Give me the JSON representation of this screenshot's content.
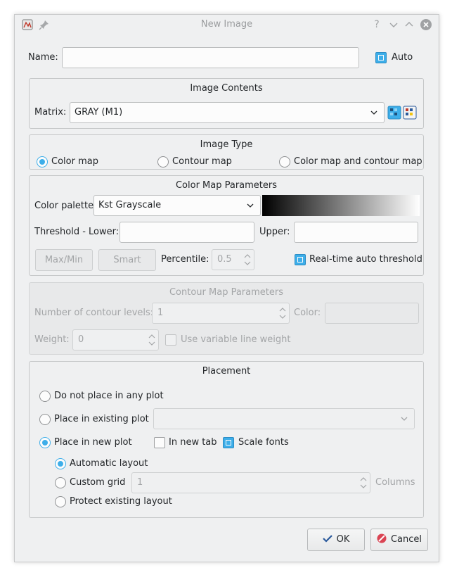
{
  "window": {
    "title": "New Image"
  },
  "name_row": {
    "label": "Name:",
    "value": "",
    "auto_label": "Auto",
    "auto_checked": true
  },
  "image_contents": {
    "title": "Image Contents",
    "matrix_label": "Matrix:",
    "matrix_value": "GRAY (M1)"
  },
  "image_type": {
    "title": "Image Type",
    "options": [
      "Color map",
      "Contour map",
      "Color map and contour map"
    ],
    "selected": "Color map"
  },
  "color_map": {
    "title": "Color Map Parameters",
    "palette_label": "Color palette:",
    "palette_value": "Kst Grayscale",
    "threshold_lower_label": "Threshold - Lower:",
    "threshold_lower_value": "",
    "upper_label": "Upper:",
    "upper_value": "",
    "maxmin_label": "Max/Min",
    "smart_label": "Smart",
    "percentile_label": "Percentile:",
    "percentile_value": "0.5",
    "realtime_label": "Real-time auto threshold",
    "realtime_checked": true
  },
  "contour": {
    "title": "Contour Map Parameters",
    "levels_label": "Number of contour levels:",
    "levels_value": "1",
    "color_label": "Color:",
    "weight_label": "Weight:",
    "weight_value": "0",
    "variable_weight_label": "Use variable line weight"
  },
  "placement": {
    "title": "Placement",
    "do_not_place": "Do not place in any plot",
    "existing_plot": "Place in existing plot",
    "new_plot": "Place in new plot",
    "in_new_tab": "In new tab",
    "scale_fonts": "Scale fonts",
    "auto_layout": "Automatic layout",
    "custom_grid": "Custom grid",
    "custom_grid_value": "1",
    "columns_label": "Columns",
    "protect_layout": "Protect existing layout"
  },
  "buttons": {
    "ok": "OK",
    "cancel": "Cancel"
  },
  "colors": {
    "accent": "#3daee9",
    "background": "#eff0f1"
  }
}
